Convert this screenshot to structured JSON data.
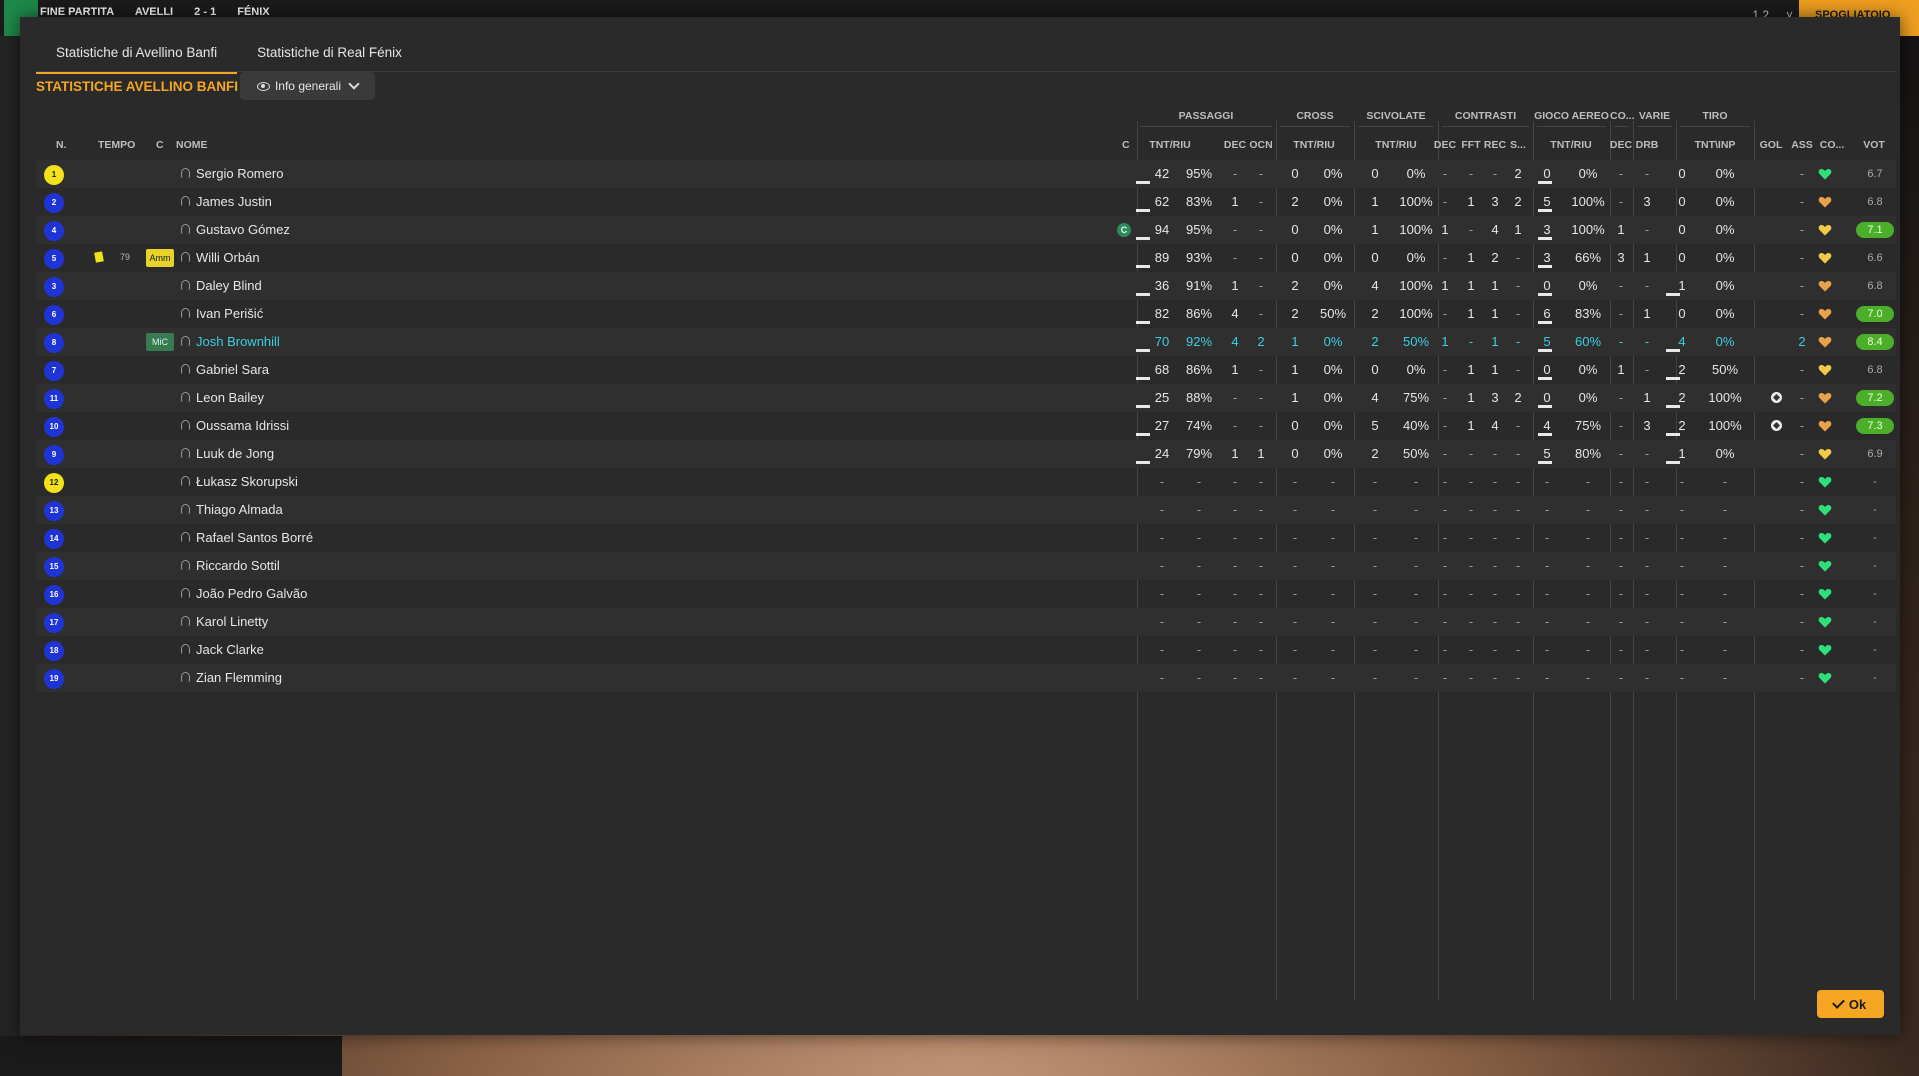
{
  "topbar": {
    "status": "FINE PARTITA",
    "home": "AVELLI",
    "score": "2 - 1",
    "away": "FÉNIX",
    "right_label": "SPOGLIATOIO",
    "mid_label": "1 2",
    "mid2_label": "˅"
  },
  "tabs": [
    {
      "label": "Statistiche di Avellino Banfi",
      "active": true
    },
    {
      "label": "Statistiche di Real Fénix",
      "active": false
    }
  ],
  "section_title": "STATISTICHE AVELLINO BANFI",
  "view_dropdown": {
    "label": "Info generali"
  },
  "groups": [
    "PASSAGGI",
    "CROSS",
    "SCIVOLATE",
    "CONTRASTI",
    "GIOCO AEREO",
    "CO...",
    "VARIE",
    "TIRO"
  ],
  "headers": {
    "num": "N.",
    "tempo": "TEMPO",
    "c": "C",
    "nome": "NOME",
    "c2": "C",
    "pass_tnt": "TNT/RIU",
    "pass_dec": "DEC",
    "pass_ocn": "OCN",
    "cross_tnt": "TNT/RIU",
    "sciv_tnt": "TNT/RIU",
    "contr_dec": "DEC",
    "contr_fft": "FFT",
    "contr_rec": "REC",
    "contr_s": "S...",
    "aereo_tnt": "TNT/RIU",
    "co_dec": "DEC",
    "varie_drb": "DRB",
    "tiro_tnt": "TNT\\INP",
    "gol": "GOL",
    "ass": "ASS",
    "con": "CO...",
    "vot": "VOT"
  },
  "players": [
    {
      "n": "1",
      "gk": true,
      "name": "Sergio Romero",
      "tempo": "",
      "badge": "",
      "cap": false,
      "pass": [
        "42",
        "95%",
        "-",
        "-"
      ],
      "cross": [
        "0",
        "0%"
      ],
      "sciv": [
        "0",
        "0%"
      ],
      "contr": [
        "-",
        "-",
        "-",
        "2"
      ],
      "aereo": [
        "0",
        "0%"
      ],
      "co": "-",
      "drb": "-",
      "tiro": [
        "0",
        "0%"
      ],
      "gol": "",
      "ass": "-",
      "vote": "6.7",
      "good": false,
      "heart": "green"
    },
    {
      "n": "2",
      "gk": false,
      "name": "James Justin",
      "tempo": "",
      "badge": "",
      "cap": false,
      "pass": [
        "62",
        "83%",
        "1",
        "-"
      ],
      "cross": [
        "2",
        "0%"
      ],
      "sciv": [
        "1",
        "100%"
      ],
      "contr": [
        "-",
        "1",
        "3",
        "2"
      ],
      "aereo": [
        "5",
        "100%"
      ],
      "co": "-",
      "drb": "3",
      "tiro": [
        "0",
        "0%"
      ],
      "gol": "",
      "ass": "-",
      "vote": "6.8",
      "good": false,
      "heart": "orange"
    },
    {
      "n": "4",
      "gk": false,
      "name": "Gustavo Gómez",
      "tempo": "",
      "badge": "",
      "cap": true,
      "cap_label": "C",
      "pass": [
        "94",
        "95%",
        "-",
        "-"
      ],
      "cross": [
        "0",
        "0%"
      ],
      "sciv": [
        "1",
        "100%"
      ],
      "contr": [
        "1",
        "-",
        "4",
        "1"
      ],
      "aereo": [
        "3",
        "100%"
      ],
      "co": "1",
      "drb": "-",
      "tiro": [
        "0",
        "0%"
      ],
      "gol": "",
      "ass": "-",
      "vote": "7.1",
      "good": true,
      "heart": "yellow"
    },
    {
      "n": "5",
      "gk": false,
      "name": "Willi Orbán",
      "tempo": "79",
      "badge": "Amm",
      "card": true,
      "cap": false,
      "pass": [
        "89",
        "93%",
        "-",
        "-"
      ],
      "cross": [
        "0",
        "0%"
      ],
      "sciv": [
        "0",
        "0%"
      ],
      "contr": [
        "-",
        "1",
        "2",
        "-"
      ],
      "aereo": [
        "3",
        "66%"
      ],
      "co": "3",
      "drb": "1",
      "tiro": [
        "0",
        "0%"
      ],
      "gol": "",
      "ass": "-",
      "vote": "6.6",
      "good": false,
      "heart": "yellow"
    },
    {
      "n": "3",
      "gk": false,
      "name": "Daley Blind",
      "tempo": "",
      "badge": "",
      "cap": false,
      "pass": [
        "36",
        "91%",
        "1",
        "-"
      ],
      "cross": [
        "2",
        "0%"
      ],
      "sciv": [
        "4",
        "100%"
      ],
      "contr": [
        "1",
        "1",
        "1",
        "-"
      ],
      "aereo": [
        "0",
        "0%"
      ],
      "co": "-",
      "drb": "-",
      "tiro": [
        "1",
        "0%"
      ],
      "gol": "",
      "ass": "-",
      "vote": "6.8",
      "good": false,
      "heart": "orange"
    },
    {
      "n": "6",
      "gk": false,
      "name": "Ivan Perišić",
      "tempo": "",
      "badge": "",
      "cap": false,
      "pass": [
        "82",
        "86%",
        "4",
        "-"
      ],
      "cross": [
        "2",
        "50%"
      ],
      "sciv": [
        "2",
        "100%"
      ],
      "contr": [
        "-",
        "1",
        "1",
        "-"
      ],
      "aereo": [
        "6",
        "83%"
      ],
      "co": "-",
      "drb": "1",
      "tiro": [
        "0",
        "0%"
      ],
      "gol": "",
      "ass": "-",
      "vote": "7.0",
      "good": true,
      "heart": "orange"
    },
    {
      "n": "8",
      "gk": false,
      "name": "Josh Brownhill",
      "sel": true,
      "tempo": "",
      "badge": "MiC",
      "cap": false,
      "pass": [
        "70",
        "92%",
        "4",
        "2"
      ],
      "cross": [
        "1",
        "0%"
      ],
      "sciv": [
        "2",
        "50%"
      ],
      "contr": [
        "1",
        "-",
        "1",
        "-"
      ],
      "aereo": [
        "5",
        "60%"
      ],
      "co": "-",
      "drb": "-",
      "tiro": [
        "4",
        "0%"
      ],
      "gol": "",
      "ass": "2",
      "vote": "8.4",
      "good": true,
      "heart": "orange"
    },
    {
      "n": "7",
      "gk": false,
      "name": "Gabriel Sara",
      "tempo": "",
      "badge": "",
      "cap": false,
      "pass": [
        "68",
        "86%",
        "1",
        "-"
      ],
      "cross": [
        "1",
        "0%"
      ],
      "sciv": [
        "0",
        "0%"
      ],
      "contr": [
        "-",
        "1",
        "1",
        "-"
      ],
      "aereo": [
        "0",
        "0%"
      ],
      "co": "1",
      "drb": "-",
      "tiro": [
        "2",
        "50%"
      ],
      "gol": "",
      "ass": "-",
      "vote": "6.8",
      "good": false,
      "heart": "yellow"
    },
    {
      "n": "11",
      "gk": false,
      "name": "Leon Bailey",
      "tempo": "",
      "badge": "",
      "cap": false,
      "pass": [
        "25",
        "88%",
        "-",
        "-"
      ],
      "cross": [
        "1",
        "0%"
      ],
      "sciv": [
        "4",
        "75%"
      ],
      "contr": [
        "-",
        "1",
        "3",
        "2"
      ],
      "aereo": [
        "0",
        "0%"
      ],
      "co": "-",
      "drb": "1",
      "tiro": [
        "2",
        "100%"
      ],
      "gol": "ball",
      "ass": "-",
      "vote": "7.2",
      "good": true,
      "heart": "orange"
    },
    {
      "n": "10",
      "gk": false,
      "name": "Oussama Idrissi",
      "tempo": "",
      "badge": "",
      "cap": false,
      "pass": [
        "27",
        "74%",
        "-",
        "-"
      ],
      "cross": [
        "0",
        "0%"
      ],
      "sciv": [
        "5",
        "40%"
      ],
      "contr": [
        "-",
        "1",
        "4",
        "-"
      ],
      "aereo": [
        "4",
        "75%"
      ],
      "co": "-",
      "drb": "3",
      "tiro": [
        "2",
        "100%"
      ],
      "gol": "ball",
      "ass": "-",
      "vote": "7.3",
      "good": true,
      "heart": "orange"
    },
    {
      "n": "9",
      "gk": false,
      "name": "Luuk de Jong",
      "tempo": "",
      "badge": "",
      "cap": false,
      "pass": [
        "24",
        "79%",
        "1",
        "1"
      ],
      "cross": [
        "0",
        "0%"
      ],
      "sciv": [
        "2",
        "50%"
      ],
      "contr": [
        "-",
        "-",
        "-",
        "-"
      ],
      "aereo": [
        "5",
        "80%"
      ],
      "co": "-",
      "drb": "-",
      "tiro": [
        "1",
        "0%"
      ],
      "gol": "",
      "ass": "-",
      "vote": "6.9",
      "good": false,
      "heart": "yellow"
    },
    {
      "n": "12",
      "gk": true,
      "name": "Łukasz Skorupski",
      "sub": true,
      "heart": "green"
    },
    {
      "n": "13",
      "gk": false,
      "name": "Thiago Almada",
      "sub": true,
      "heart": "green"
    },
    {
      "n": "14",
      "gk": false,
      "name": "Rafael Santos Borré",
      "sub": true,
      "heart": "green"
    },
    {
      "n": "15",
      "gk": false,
      "name": "Riccardo Sottil",
      "sub": true,
      "heart": "green"
    },
    {
      "n": "16",
      "gk": false,
      "name": "João Pedro Galvão",
      "sub": true,
      "heart": "green"
    },
    {
      "n": "17",
      "gk": false,
      "name": "Karol Linetty",
      "sub": true,
      "heart": "green"
    },
    {
      "n": "18",
      "gk": false,
      "name": "Jack Clarke",
      "sub": true,
      "heart": "green"
    },
    {
      "n": "19",
      "gk": false,
      "name": "Zian Flemming",
      "sub": true,
      "heart": "green"
    }
  ],
  "ok_label": "Ok",
  "colors": {
    "accent": "#f6a623",
    "selected": "#3ccfe0",
    "vote_good": "#4caf2a",
    "heart_green": "#2ee07a",
    "heart_orange": "#e8a24a",
    "heart_yellow": "#f0c84a"
  }
}
